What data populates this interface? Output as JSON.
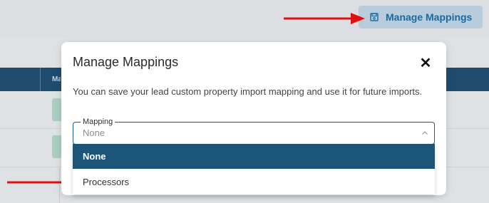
{
  "toolbar": {
    "manage_mappings_label": "Manage Mappings",
    "manage_mappings_icon": "save-icon"
  },
  "table": {
    "header_partial": "Ma"
  },
  "modal": {
    "title": "Manage Mappings",
    "close_icon": "close-icon",
    "description": "You can save your lead custom property import mapping and use it for future imports.",
    "mapping_field": {
      "label": "Mapping",
      "selected_value": "None",
      "chevron_icon": "chevron-up-icon"
    },
    "dropdown_options": [
      {
        "label": "None",
        "selected": true
      },
      {
        "label": "Processors",
        "selected": false
      }
    ]
  },
  "colors": {
    "primary": "#1b5577",
    "accent_button_bg": "#b9ccdc",
    "arrow": "#e01010"
  }
}
